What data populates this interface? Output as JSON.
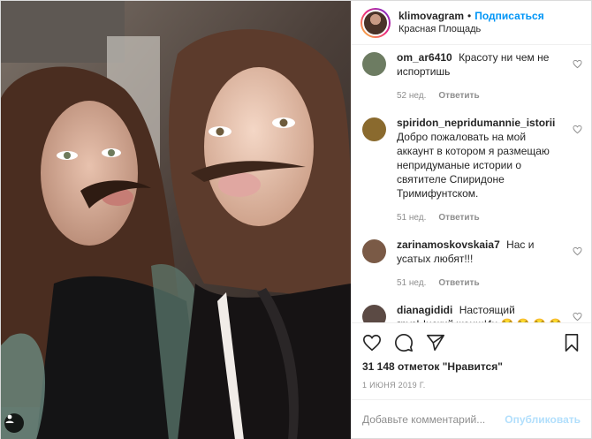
{
  "header": {
    "username": "klimovagram",
    "separator": "•",
    "follow_label": "Подписаться",
    "location": "Красная Площадь"
  },
  "comments": [
    {
      "user": "om_ar6410",
      "text": "Красоту ни чем не испортишь",
      "age": "52 нед.",
      "reply_label": "Ответить",
      "avatar_color": "#6d7c62"
    },
    {
      "user": "spiridon_nepridumannie_istorii",
      "text": "Добро пожаловать на мой аккаунт в котором я размещаю непридуманые истории о святителе Спиридоне Тримифунтском.",
      "age": "51 нед.",
      "reply_label": "Ответить",
      "avatar_color": "#8a6a2e"
    },
    {
      "user": "zarinamoskovskaia7",
      "text": "Нас и усатых любят!!!",
      "age": "51 нед.",
      "reply_label": "Ответить",
      "avatar_color": "#7a5a46"
    },
    {
      "user": "dianagididi",
      "text": "Настоящий грузЫнский женщИн 😂 😂 😂 😂",
      "age": "",
      "reply_label": "",
      "avatar_color": "#5b4a44"
    }
  ],
  "actions": {
    "likes": "31 148 отметок \"Нравится\"",
    "date": "1 ИЮНЯ 2019 Г."
  },
  "add_comment": {
    "placeholder": "Добавьте комментарий...",
    "publish_label": "Опубликовать"
  },
  "icons": [
    "heart-icon",
    "comment-icon",
    "share-icon",
    "bookmark-icon",
    "user-tag-icon"
  ]
}
